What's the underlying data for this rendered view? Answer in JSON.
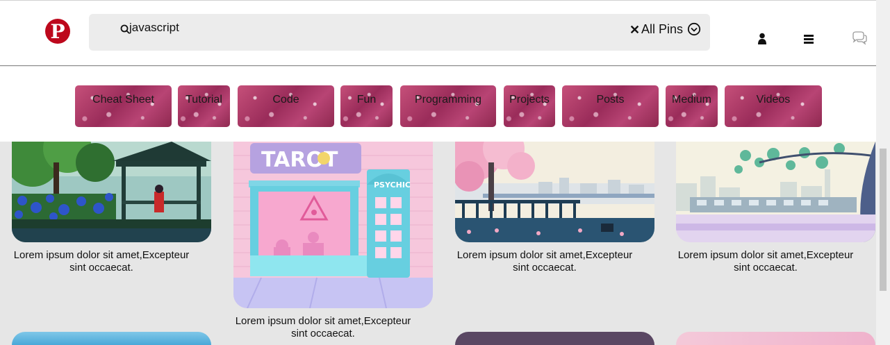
{
  "header": {
    "logo_letter": "P",
    "search": {
      "query": "javascript",
      "filter_label": "All Pins",
      "clear_symbol": "✕"
    },
    "icons": [
      "profile-icon",
      "menu-icon",
      "messages-icon"
    ]
  },
  "categories": [
    "Cheat Sheet",
    "Tutorial",
    "Code",
    "Fun",
    "Programming",
    "Projects",
    "Posts",
    "Medium",
    "Videos"
  ],
  "feed": {
    "pins": [
      {
        "caption_line1": "Lorem ipsum dolor sit amet,Excepteur",
        "caption_line2": "sint occaecat."
      },
      {
        "caption_line1": "Lorem ipsum dolor sit amet,Excepteur",
        "caption_line2": "sint occaecat.",
        "sign_tarot": "TAROT",
        "sign_psychic": "PSYCHIC"
      },
      {
        "caption_line1": "Lorem ipsum dolor sit amet,Excepteur",
        "caption_line2": "sint occaecat."
      },
      {
        "caption_line1": "Lorem ipsum dolor sit amet,Excepteur",
        "caption_line2": "sint occaecat."
      }
    ]
  },
  "colors": {
    "brand": "#bd081c",
    "category_tile": "#b13f6b",
    "page_bg": "#e6e6e6"
  }
}
